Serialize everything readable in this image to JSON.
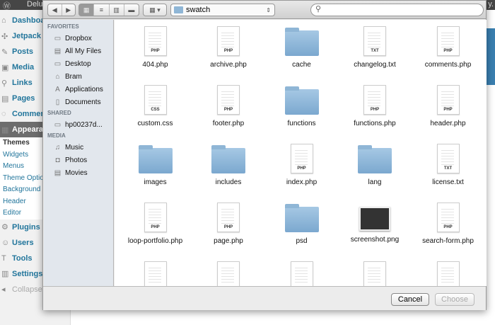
{
  "wp": {
    "site": "Delux",
    "right": "y.",
    "menu": [
      {
        "icon": "⌂",
        "label": "Dashboard"
      },
      {
        "icon": "✣",
        "label": "Jetpack"
      },
      {
        "icon": "✎",
        "label": "Posts"
      },
      {
        "icon": "▣",
        "label": "Media"
      },
      {
        "icon": "⚲",
        "label": "Links"
      },
      {
        "icon": "▤",
        "label": "Pages"
      },
      {
        "icon": "◌",
        "label": "Comments"
      },
      {
        "icon": "▦",
        "label": "Appearance"
      }
    ],
    "submenu": [
      "Themes",
      "Widgets",
      "Menus",
      "Theme Options",
      "Background",
      "Header",
      "Editor"
    ],
    "menu2": [
      {
        "icon": "⚙",
        "label": "Plugins"
      },
      {
        "icon": "☺",
        "label": "Users"
      },
      {
        "icon": "T",
        "label": "Tools"
      },
      {
        "icon": "▥",
        "label": "Settings"
      }
    ],
    "collapse": "Collapse menu"
  },
  "dialog": {
    "toolbar": {
      "back": "◀",
      "forward": "▶",
      "views": [
        "▦",
        "≡",
        "▥",
        "▬"
      ],
      "arrange": "▦ ▾",
      "path": "swatch",
      "search_placeholder": ""
    },
    "sidebar": [
      {
        "header": "FAVORITES",
        "items": [
          {
            "icon": "▭",
            "label": "Dropbox"
          },
          {
            "icon": "▤",
            "label": "All My Files"
          },
          {
            "icon": "▭",
            "label": "Desktop"
          },
          {
            "icon": "⌂",
            "label": "Bram"
          },
          {
            "icon": "A",
            "label": "Applications"
          },
          {
            "icon": "▯",
            "label": "Documents"
          }
        ]
      },
      {
        "header": "SHARED",
        "items": [
          {
            "icon": "▭",
            "label": "hp00237d..."
          }
        ]
      },
      {
        "header": "MEDIA",
        "items": [
          {
            "icon": "♫",
            "label": "Music"
          },
          {
            "icon": "◘",
            "label": "Photos"
          },
          {
            "icon": "▤",
            "label": "Movies"
          }
        ]
      }
    ],
    "files": [
      {
        "name": "404.php",
        "type": "doc",
        "ext": "PHP"
      },
      {
        "name": "archive.php",
        "type": "doc",
        "ext": "PHP"
      },
      {
        "name": "cache",
        "type": "folder"
      },
      {
        "name": "changelog.txt",
        "type": "doc",
        "ext": "TXT"
      },
      {
        "name": "comments.php",
        "type": "doc",
        "ext": "PHP"
      },
      {
        "name": "custom.css",
        "type": "doc",
        "ext": "CSS"
      },
      {
        "name": "footer.php",
        "type": "doc",
        "ext": "PHP"
      },
      {
        "name": "functions",
        "type": "folder"
      },
      {
        "name": "functions.php",
        "type": "doc",
        "ext": "PHP"
      },
      {
        "name": "header.php",
        "type": "doc",
        "ext": "PHP"
      },
      {
        "name": "images",
        "type": "folder"
      },
      {
        "name": "includes",
        "type": "folder"
      },
      {
        "name": "index.php",
        "type": "doc",
        "ext": "PHP"
      },
      {
        "name": "lang",
        "type": "folder"
      },
      {
        "name": "license.txt",
        "type": "doc",
        "ext": "TXT"
      },
      {
        "name": "loop-portfolio.php",
        "type": "doc",
        "ext": "PHP"
      },
      {
        "name": "page.php",
        "type": "doc",
        "ext": "PHP"
      },
      {
        "name": "psd",
        "type": "folder"
      },
      {
        "name": "screenshot.png",
        "type": "image"
      },
      {
        "name": "search-form.php",
        "type": "doc",
        "ext": "PHP"
      },
      {
        "name": "",
        "type": "doc",
        "ext": ""
      },
      {
        "name": "",
        "type": "doc",
        "ext": ""
      },
      {
        "name": "",
        "type": "doc",
        "ext": ""
      },
      {
        "name": "",
        "type": "doc",
        "ext": ""
      },
      {
        "name": "",
        "type": "doc",
        "ext": ""
      }
    ],
    "cancel": "Cancel",
    "choose": "Choose"
  }
}
